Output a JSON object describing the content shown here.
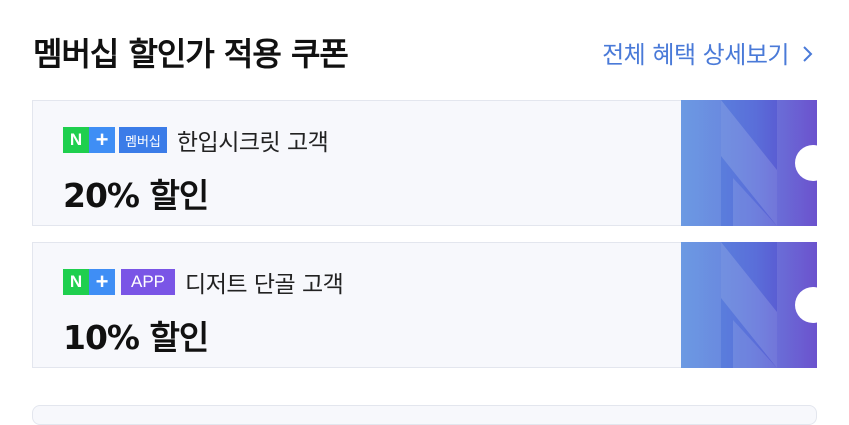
{
  "header": {
    "title": "멤버십 할인가 적용 쿠폰",
    "see_all": "전체 혜택 상세보기"
  },
  "coupons": [
    {
      "badge_n": "N",
      "badge_plus": "+",
      "tag": "멤버십",
      "target": "한입시크릿 고객",
      "discount": "20% 할인"
    },
    {
      "badge_n": "N",
      "badge_plus": "+",
      "tag": "APP",
      "target": "디저트 단골 고객",
      "discount": "10% 할인"
    }
  ],
  "icons": {
    "see_all": "chevron-right-icon",
    "stub": "naver-n-pattern-icon"
  },
  "colors": {
    "accent": "#4a7ad8",
    "naver_green": "#1fcf4e",
    "plus_blue": "#3f8ef5",
    "app_purple": "#7a55e6",
    "stub_start": "#5b8fe0",
    "stub_end": "#5b3fc8"
  }
}
